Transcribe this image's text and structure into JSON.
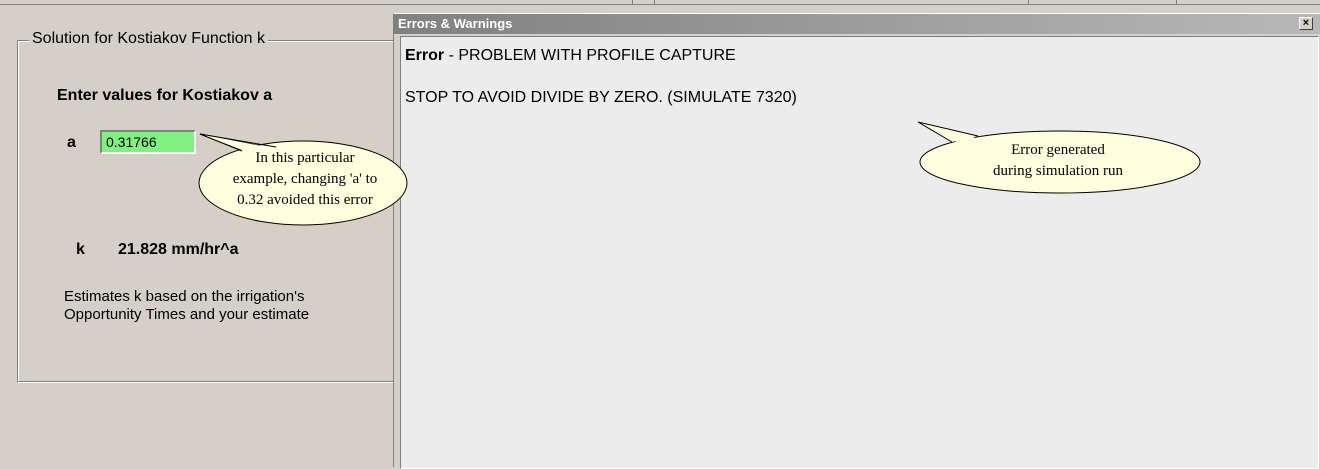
{
  "left_panel": {
    "group_title": "Solution for Kostiakov Function k",
    "enter_label": "Enter values for Kostiakov a",
    "a_label": "a",
    "a_value": "0.31766",
    "k_label": "k",
    "k_value": "21.828 mm/hr^a",
    "description_line1": "Estimates k based on the irrigation's",
    "description_line2": "Opportunity Times and your estimate"
  },
  "error_window": {
    "title": "Errors & Warnings",
    "close_glyph": "×",
    "error_prefix": "Error",
    "error_message": " - PROBLEM WITH PROFILE CAPTURE",
    "detail": "STOP TO AVOID DIVIDE BY ZERO.  (SIMULATE 7320)"
  },
  "callouts": {
    "left": {
      "line1": "In this particular",
      "line2": "example, changing 'a' to",
      "line3": "0.32 avoided this error"
    },
    "right": {
      "line1": "Error generated",
      "line2": "during simulation run"
    }
  },
  "colors": {
    "input_bg": "#80f080",
    "window_bg": "#d4d0c8",
    "callout_fill": "#ffffe0"
  }
}
